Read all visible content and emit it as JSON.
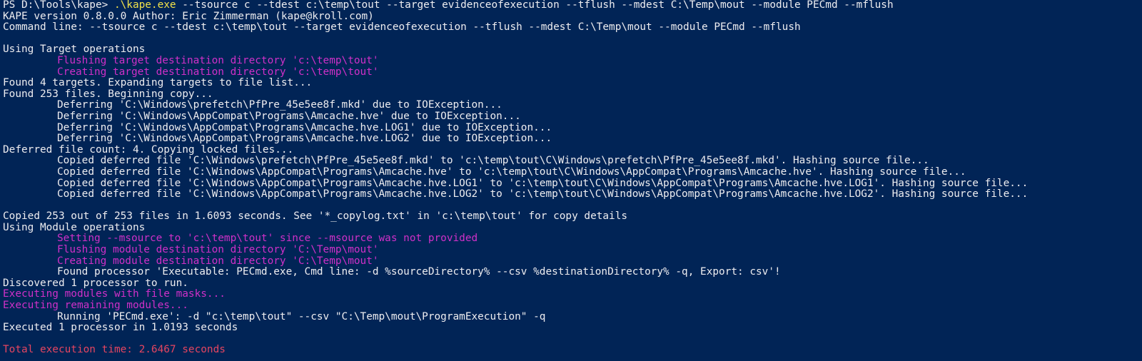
{
  "terminal": {
    "prompt": {
      "path": "PS D:\\Tools\\kape> ",
      "command_exe": ".\\kape.exe",
      "command_args": " --tsource c --tdest c:\\temp\\tout --target evidenceofexecution --tflush --mdest C:\\Temp\\mout --module PECmd --mflush"
    },
    "lines": [
      {
        "text": "KAPE version 0.8.0.0 Author: Eric Zimmerman (kape@kroll.com)"
      },
      {
        "text": "Command line: --tsource c --tdest c:\\temp\\tout --target evidenceofexecution --tflush --mdest C:\\Temp\\mout --module PECmd --mflush"
      },
      {
        "text": ""
      },
      {
        "text": "Using Target operations"
      },
      {
        "text": "Flushing target destination directory 'c:\\temp\\tout'"
      },
      {
        "text": "Creating target destination directory 'c:\\temp\\tout'"
      },
      {
        "text": "Found 4 targets. Expanding targets to file list..."
      },
      {
        "text": "Found 253 files. Beginning copy..."
      },
      {
        "text": "Deferring 'C:\\Windows\\prefetch\\PfPre_45e5ee8f.mkd' due to IOException..."
      },
      {
        "text": "Deferring 'C:\\Windows\\AppCompat\\Programs\\Amcache.hve' due to IOException..."
      },
      {
        "text": "Deferring 'C:\\Windows\\AppCompat\\Programs\\Amcache.hve.LOG1' due to IOException..."
      },
      {
        "text": "Deferring 'C:\\Windows\\AppCompat\\Programs\\Amcache.hve.LOG2' due to IOException..."
      },
      {
        "text": "Deferred file count: 4. Copying locked files..."
      },
      {
        "text": "Copied deferred file 'C:\\Windows\\prefetch\\PfPre_45e5ee8f.mkd' to 'c:\\temp\\tout\\C\\Windows\\prefetch\\PfPre_45e5ee8f.mkd'. Hashing source file..."
      },
      {
        "text": "Copied deferred file 'C:\\Windows\\AppCompat\\Programs\\Amcache.hve' to 'c:\\temp\\tout\\C\\Windows\\AppCompat\\Programs\\Amcache.hve'. Hashing source file..."
      },
      {
        "text": "Copied deferred file 'C:\\Windows\\AppCompat\\Programs\\Amcache.hve.LOG1' to 'c:\\temp\\tout\\C\\Windows\\AppCompat\\Programs\\Amcache.hve.LOG1'. Hashing source file..."
      },
      {
        "text": "Copied deferred file 'C:\\Windows\\AppCompat\\Programs\\Amcache.hve.LOG2' to 'c:\\temp\\tout\\C\\Windows\\AppCompat\\Programs\\Amcache.hve.LOG2'. Hashing source file..."
      },
      {
        "text": ""
      },
      {
        "text": "Copied 253 out of 253 files in 1.6093 seconds. See '*_copylog.txt' in 'c:\\temp\\tout' for copy details"
      },
      {
        "text": "Using Module operations"
      },
      {
        "text": "Setting --msource to 'c:\\temp\\tout' since --msource was not provided"
      },
      {
        "text": "Flushing module destination directory 'C:\\Temp\\mout'"
      },
      {
        "text": "Creating module destination directory 'C:\\Temp\\mout'"
      },
      {
        "text": "Found processor 'Executable: PECmd.exe, Cmd line: -d %sourceDirectory% --csv %destinationDirectory% -q, Export: csv'!"
      },
      {
        "text": "Discovered 1 processor to run."
      },
      {
        "text": "Executing modules with file masks..."
      },
      {
        "text": "Executing remaining modules..."
      },
      {
        "text": "Running 'PECmd.exe': -d \"c:\\temp\\tout\" --csv \"C:\\Temp\\mout\\ProgramExecution\" -q"
      },
      {
        "text": "Executed 1 processor in 1.0193 seconds"
      },
      {
        "text": ""
      },
      {
        "text": "Total execution time: 2.6467 seconds"
      }
    ]
  },
  "colors": {
    "background": "#012456",
    "default_text": "#eeedf0",
    "magenta": "#d030c8",
    "red": "#e64560",
    "yellow": "#f2e24a"
  }
}
